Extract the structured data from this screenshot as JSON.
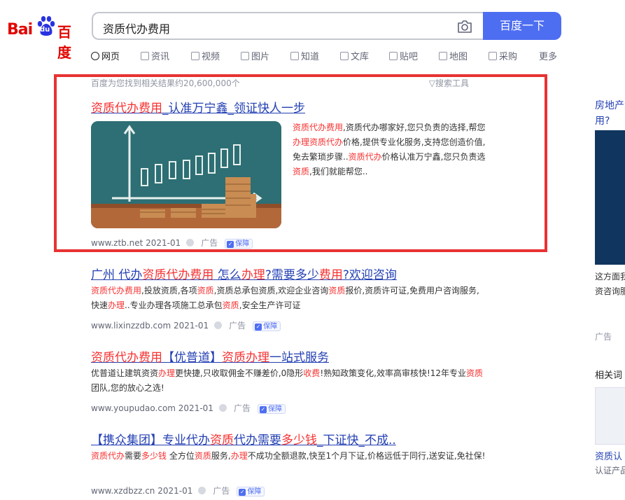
{
  "header": {
    "logo": {
      "latin": "Bai",
      "paw_text": "du",
      "cn": "百度"
    },
    "search": {
      "query": "资质代办费用"
    },
    "search_button": "百度一下"
  },
  "tabs": [
    {
      "label": "网页"
    },
    {
      "label": "资讯"
    },
    {
      "label": "视频"
    },
    {
      "label": "图片"
    },
    {
      "label": "知道"
    },
    {
      "label": "文库"
    },
    {
      "label": "贴吧"
    },
    {
      "label": "地图"
    },
    {
      "label": "采购"
    },
    {
      "label": "更多"
    }
  ],
  "meta": {
    "result_count": "百度为您找到相关结果约20,600,000个",
    "search_tools": "搜索工具"
  },
  "results": [
    {
      "title_parts": [
        {
          "t": "资质代办费用",
          "hl": true
        },
        {
          "t": "_认准万宁鑫_领证快人一步",
          "hl": false
        }
      ],
      "desc_parts": [
        {
          "t": "资质代办费用",
          "hl": true
        },
        {
          "t": ",资质代办哪家好,您只负责的选择,帮您",
          "hl": false
        },
        {
          "t": "办理",
          "hl": true
        },
        {
          "t": "资质代办",
          "hl": true
        },
        {
          "t": "价格,提供专业化服务,支持您创造价值,免去繁琐步骤..",
          "hl": false
        },
        {
          "t": "资质代办",
          "hl": true
        },
        {
          "t": "价格认准万宁鑫,您只负责选",
          "hl": false
        },
        {
          "t": "资质",
          "hl": true
        },
        {
          "t": ",我们就能帮您..",
          "hl": false
        }
      ],
      "url": "www.ztb.net 2021-01",
      "ad_label": "广告",
      "badge": "保障"
    },
    {
      "title_parts": [
        {
          "t": "广州 代办",
          "hl": false
        },
        {
          "t": "资质代办费用",
          "hl": true
        },
        {
          "t": " 怎么",
          "hl": false
        },
        {
          "t": "办理",
          "hl": true
        },
        {
          "t": "?需要多少",
          "hl": false
        },
        {
          "t": "费用",
          "hl": true
        },
        {
          "t": "?欢迎咨询",
          "hl": false
        }
      ],
      "desc_parts": [
        {
          "t": "资质代办费用",
          "hl": true
        },
        {
          "t": ",投放资质,各项",
          "hl": false
        },
        {
          "t": "资质",
          "hl": true
        },
        {
          "t": ",资质总承包资质,欢迎企业咨询",
          "hl": false
        },
        {
          "t": "资质",
          "hl": true
        },
        {
          "t": "报价,资质许可证,免费用户咨询服务,快速",
          "hl": false
        },
        {
          "t": "办理",
          "hl": true
        },
        {
          "t": "..专业办理各项施工总承包",
          "hl": false
        },
        {
          "t": "资质",
          "hl": true
        },
        {
          "t": ",安全生产许可证",
          "hl": false
        }
      ],
      "url": "www.lixinzzdb.com 2021-01",
      "ad_label": "广告",
      "badge": "保障"
    },
    {
      "title_parts": [
        {
          "t": "资质代办费用",
          "hl": true
        },
        {
          "t": "【优普道】",
          "hl": false
        },
        {
          "t": "资质办理",
          "hl": true
        },
        {
          "t": "一站式服务",
          "hl": false
        }
      ],
      "desc_parts": [
        {
          "t": "优普道让建筑资资",
          "hl": false
        },
        {
          "t": "办理",
          "hl": true
        },
        {
          "t": "更快捷,只收取佣金不赚差价,0隐形",
          "hl": false
        },
        {
          "t": "收费",
          "hl": true
        },
        {
          "t": "!熟知政策变化,效率高审核快!12年专业",
          "hl": false
        },
        {
          "t": "资质",
          "hl": true
        },
        {
          "t": "团队,您的放心之选!",
          "hl": false
        }
      ],
      "url": "www.youpudao.com 2021-01",
      "ad_label": "广告",
      "badge": "保障"
    },
    {
      "title_parts": [
        {
          "t": "【携众集团】专业代办",
          "hl": false
        },
        {
          "t": "资质",
          "hl": true
        },
        {
          "t": "代办需要",
          "hl": false
        },
        {
          "t": "多少钱",
          "hl": true
        },
        {
          "t": "_下证快_不成..",
          "hl": false
        }
      ],
      "desc_parts": [
        {
          "t": "资质代办",
          "hl": true
        },
        {
          "t": "需要",
          "hl": false
        },
        {
          "t": "多少钱",
          "hl": true
        },
        {
          "t": " 全方位",
          "hl": false
        },
        {
          "t": "资质",
          "hl": true
        },
        {
          "t": "服务,",
          "hl": false
        },
        {
          "t": "办理",
          "hl": true
        },
        {
          "t": "不成功全额退款,快至1个月下证,价格远低于同行,送安证,免社保!",
          "hl": false
        }
      ],
      "url": "www.xzdbzz.cn 2021-01",
      "ad_label": "广告",
      "badge": "保障"
    }
  ],
  "right_col": {
    "title": "房地产资质代办费用?",
    "text": "这方面我们中量信联合资咨询服务宗旨,以",
    "ad_label": "广告",
    "related": "相关词",
    "link": "资质认",
    "sub": "认证产品体系标准"
  }
}
